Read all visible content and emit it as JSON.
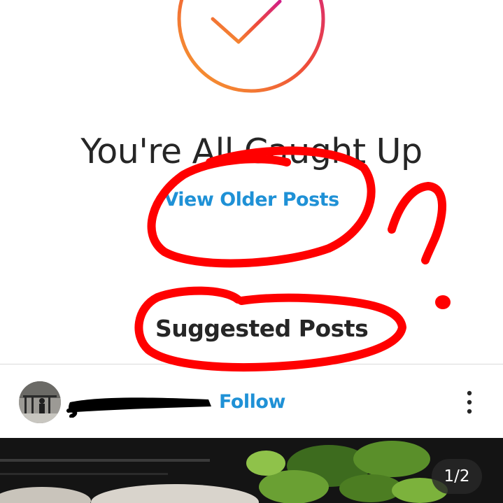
{
  "feed_end": {
    "title": "You're All Caught Up",
    "view_older_label": "View Older Posts",
    "badge_icon": "checkmark-circle-icon",
    "badge_gradient": [
      "#f58529",
      "#dd2a7b",
      "#e1306c"
    ]
  },
  "suggested": {
    "heading": "Suggested Posts"
  },
  "post": {
    "follow_label": "Follow",
    "more_icon": "more-vertical-icon",
    "page_indicator": "1/2"
  },
  "colors": {
    "link_blue": "#1f91d6",
    "text_dark": "#262626",
    "annotation_red": "#ff0000"
  }
}
